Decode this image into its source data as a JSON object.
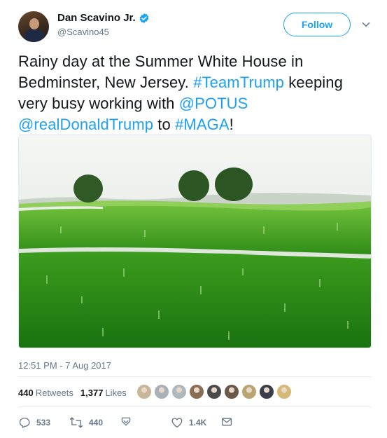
{
  "author": {
    "display_name": "Dan Scavino Jr.",
    "handle": "@Scavino45",
    "verified": true,
    "avatar_icon": "profile-photo"
  },
  "follow_button": {
    "label": "Follow",
    "color": "#1da1f2"
  },
  "tweet": {
    "segments": [
      {
        "text": "Rainy day at the Summer White House in Bedminster, New Jersey. ",
        "link": false
      },
      {
        "text": "#TeamTrump",
        "link": true
      },
      {
        "text": " keeping very busy working with ",
        "link": false
      },
      {
        "text": "@POTUS",
        "link": true
      },
      {
        "text": " ",
        "link": false
      },
      {
        "text": "@realDonaldTrump",
        "link": true
      },
      {
        "text": " to ",
        "link": false
      },
      {
        "text": "#MAGA",
        "link": true
      },
      {
        "text": "!",
        "link": false
      }
    ]
  },
  "media": {
    "type": "photo",
    "icon": "landscape-photo"
  },
  "timestamp": "12:51 PM - 7 Aug 2017",
  "stats": {
    "retweets_count": "440",
    "retweets_label": "Retweets",
    "likes_count": "1,377",
    "likes_label": "Likes"
  },
  "likers_avatar_count": 9,
  "actions": {
    "reply_count": "533",
    "retweet_count": "440",
    "like_count": "1.4K"
  },
  "colors": {
    "link": "#1da1f2",
    "secondary_text": "#657786",
    "primary_text": "#14171a"
  }
}
